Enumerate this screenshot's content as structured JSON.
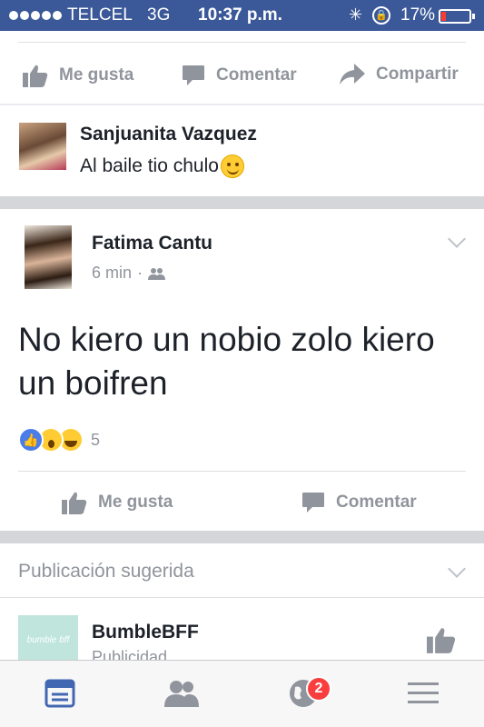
{
  "status_bar": {
    "carrier": "TELCEL",
    "network": "3G",
    "time": "10:37 p.m.",
    "battery_percent": "17%",
    "battery_level": 0.17,
    "colors": {
      "background": "#3b5998",
      "battery_low": "#ff3b30"
    }
  },
  "top_actions": {
    "like_label": "Me gusta",
    "comment_label": "Comentar",
    "share_label": "Compartir"
  },
  "comment": {
    "author": "Sanjuanita Vazquez",
    "text": "Al baile tio chulo",
    "emoji": "smiling-face-icon"
  },
  "post": {
    "author": "Fatima Cantu",
    "time": "6 min",
    "separator": "·",
    "audience_icon": "friends-icon",
    "text": "No kiero un nobio zolo kiero un boifren",
    "reactions": [
      "like-reaction-icon",
      "wow-reaction-icon",
      "haha-reaction-icon"
    ],
    "reaction_count": "5",
    "like_label": "Me gusta",
    "comment_label": "Comentar"
  },
  "suggested": {
    "header": "Publicación sugerida",
    "page_name": "BumbleBFF",
    "sponsored": "Publicidad",
    "logo_text": "bumble bff"
  },
  "tab_bar": {
    "tabs": [
      "news-feed-icon",
      "friends-icon",
      "notifications-globe-icon",
      "menu-icon"
    ],
    "notification_badge": "2",
    "colors": {
      "active": "#4267b2",
      "inactive": "#90949c",
      "badge": "#fa3e3e"
    }
  }
}
